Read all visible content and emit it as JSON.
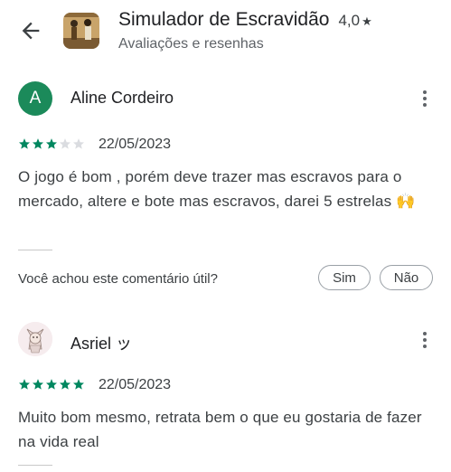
{
  "header": {
    "title": "Simulador de Escravidão",
    "rating": "4,0",
    "rating_star": "★",
    "subtitle": "Avaliações e resenhas"
  },
  "reviews": [
    {
      "avatar_letter": "A",
      "name": "Aline Cordeiro",
      "stars": 3,
      "stars_max": 5,
      "date": "22/05/2023",
      "text": "O jogo é bom , porém deve trazer mas escravos para o mercado, altere e bote mas escravos, darei 5 estrelas 🙌",
      "helpful_question": "Você achou este comentário útil?",
      "yes_label": "Sim",
      "no_label": "Não"
    },
    {
      "name": "Asriel ッ",
      "stars": 5,
      "stars_max": 5,
      "date": "22/05/2023",
      "text": "Muito bom mesmo, retrata bem o que eu gostaria de fazer na vida real"
    }
  ],
  "colors": {
    "star_filled": "#01875f",
    "star_empty": "#dadce0",
    "avatar_bg": "#1b8a5a"
  }
}
